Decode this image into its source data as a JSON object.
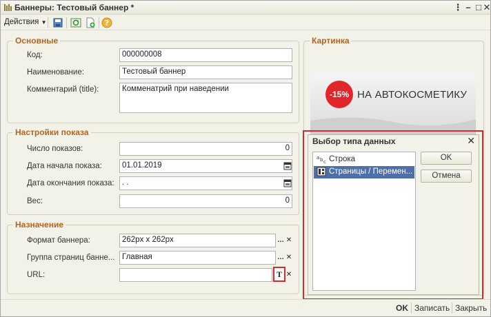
{
  "window": {
    "title": "Баннеры: Тестовый баннер *"
  },
  "toolbar": {
    "actions_label": "Действия"
  },
  "groups": {
    "main": {
      "title": "Основные",
      "code_label": "Код:",
      "code_value": "000000008",
      "name_label": "Наименование:",
      "name_value": "Тестовый баннер",
      "comment_label": "Комментарий (title):",
      "comment_value": "Комменатрий при наведении"
    },
    "display": {
      "title": "Настройки показа",
      "count_label": "Число показов:",
      "count_value": "0",
      "start_label": "Дата начала показа:",
      "start_value": "01.01.2019",
      "end_label": "Дата окончания показа:",
      "end_value": " .  .",
      "weight_label": "Вес:",
      "weight_value": "0"
    },
    "purpose": {
      "title": "Назначение",
      "format_label": "Формат баннера:",
      "format_value": "262px x 262px",
      "group_label": "Группа страниц банне...",
      "group_value": "Главная",
      "url_label": "URL:",
      "url_value": "",
      "type_button": "T"
    },
    "picture": {
      "title": "Картинка",
      "badge": "-15%",
      "banner_text": "НА АВТОКОСМЕТИКУ"
    }
  },
  "dialog": {
    "title": "Выбор типа данных",
    "items": [
      {
        "icon": "abc",
        "label": "Строка"
      },
      {
        "icon": "ref",
        "label": "Страницы / Перемен..."
      }
    ],
    "ok": "OK",
    "cancel": "Отмена"
  },
  "footer": {
    "ok": "OK",
    "save": "Записать",
    "close": "Закрыть"
  },
  "colors": {
    "accent": "#b7631f",
    "selection": "#4f6fa8",
    "highlight_frame": "#d22b2b",
    "badge": "#e0262b"
  }
}
